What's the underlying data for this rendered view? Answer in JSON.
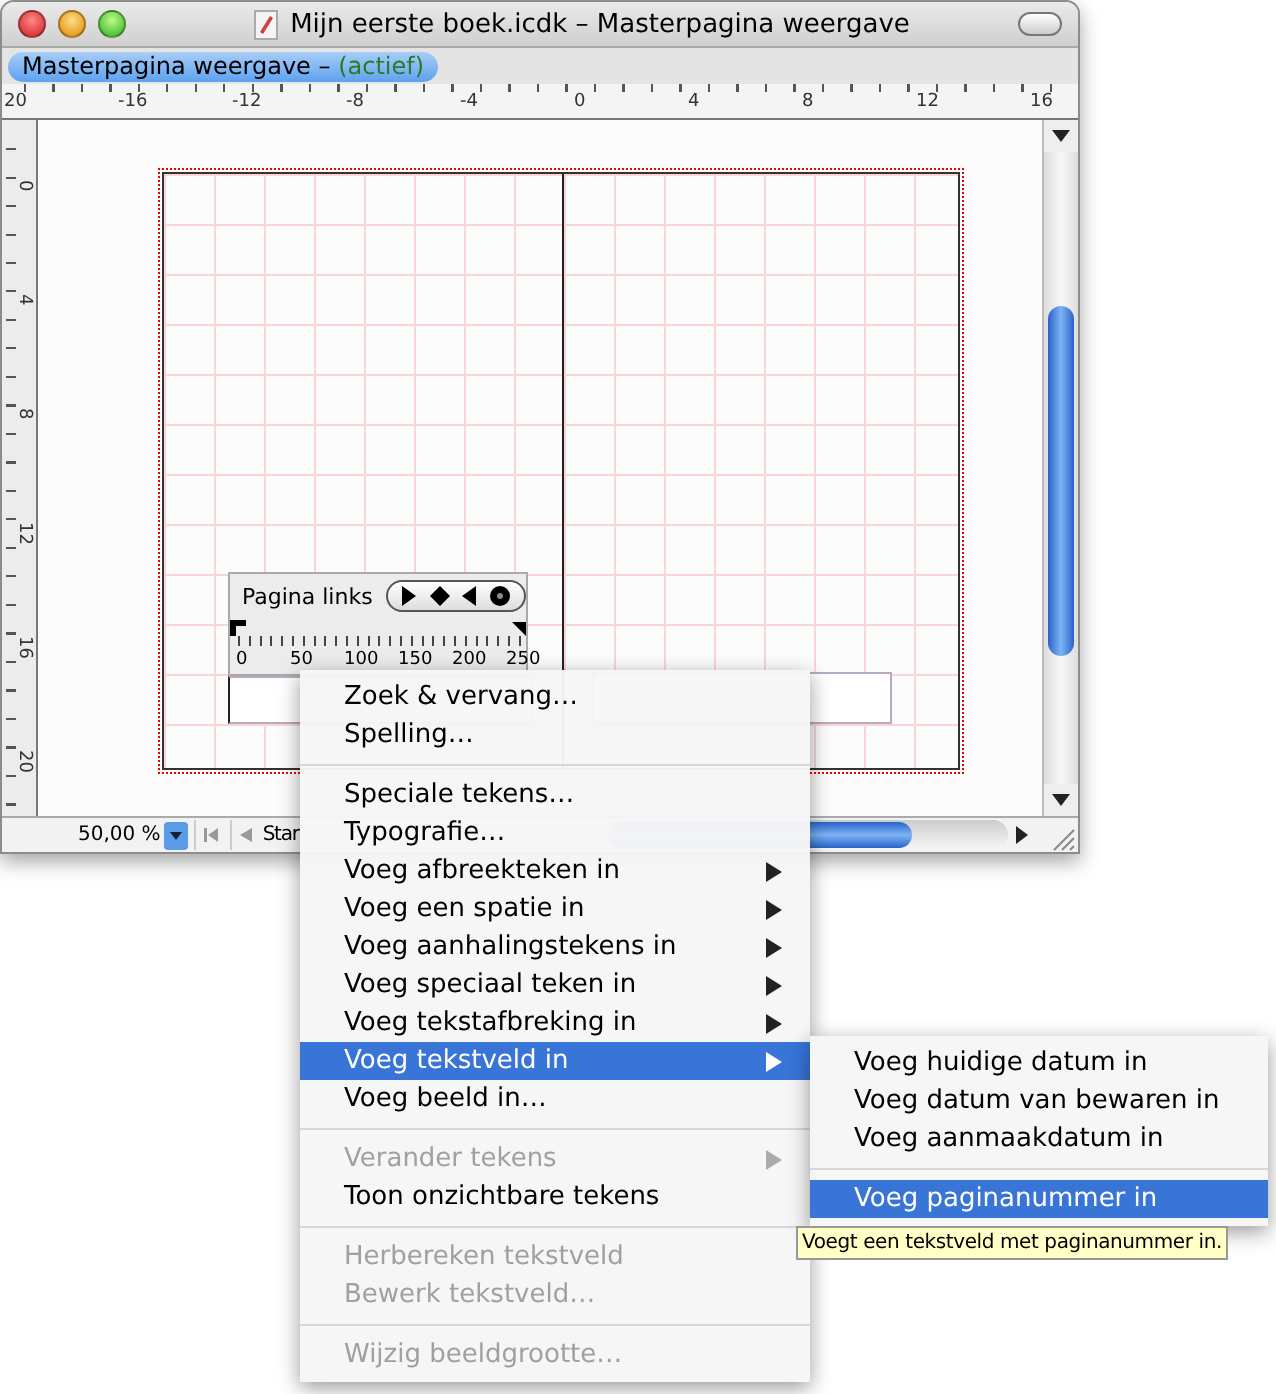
{
  "window": {
    "title": "Mijn eerste boek.icdk – Masterpagina weergave"
  },
  "tabs": [
    {
      "label": "Masterpagina weergave –",
      "status": "(actief)",
      "selected": true
    }
  ],
  "top_ruler": {
    "labels": [
      "20",
      "-16",
      "-12",
      "-8",
      "-4",
      "0",
      "4",
      "8",
      "12",
      "16"
    ]
  },
  "left_ruler": {
    "labels": [
      "0",
      "4",
      "8",
      "12",
      "16",
      "20"
    ]
  },
  "palette": {
    "title": "Pagina links",
    "scale": [
      "0",
      "50",
      "100",
      "150",
      "200",
      "250"
    ]
  },
  "status_bar": {
    "zoom": "50,00 %",
    "page_field": "Star"
  },
  "context_menu": {
    "items": [
      {
        "kind": "item",
        "label": "Zoek & vervang…",
        "has_submenu": false,
        "disabled": false,
        "selected": false
      },
      {
        "kind": "item",
        "label": "Spelling…",
        "has_submenu": false,
        "disabled": false,
        "selected": false
      },
      {
        "kind": "separator"
      },
      {
        "kind": "item",
        "label": "Speciale tekens…",
        "has_submenu": false,
        "disabled": false,
        "selected": false
      },
      {
        "kind": "item",
        "label": "Typografie…",
        "has_submenu": false,
        "disabled": false,
        "selected": false
      },
      {
        "kind": "item",
        "label": "Voeg afbreekteken in",
        "has_submenu": true,
        "disabled": false,
        "selected": false
      },
      {
        "kind": "item",
        "label": "Voeg een spatie in",
        "has_submenu": true,
        "disabled": false,
        "selected": false
      },
      {
        "kind": "item",
        "label": "Voeg aanhalingstekens in",
        "has_submenu": true,
        "disabled": false,
        "selected": false
      },
      {
        "kind": "item",
        "label": "Voeg speciaal teken in",
        "has_submenu": true,
        "disabled": false,
        "selected": false
      },
      {
        "kind": "item",
        "label": "Voeg tekstafbreking in",
        "has_submenu": true,
        "disabled": false,
        "selected": false
      },
      {
        "kind": "item",
        "label": "Voeg tekstveld in",
        "has_submenu": true,
        "disabled": false,
        "selected": true
      },
      {
        "kind": "item",
        "label": "Voeg beeld in…",
        "has_submenu": false,
        "disabled": false,
        "selected": false
      },
      {
        "kind": "separator"
      },
      {
        "kind": "item",
        "label": "Verander tekens",
        "has_submenu": true,
        "disabled": true,
        "selected": false
      },
      {
        "kind": "item",
        "label": "Toon onzichtbare tekens",
        "has_submenu": false,
        "disabled": false,
        "selected": false
      },
      {
        "kind": "separator"
      },
      {
        "kind": "item",
        "label": "Herbereken tekstveld",
        "has_submenu": false,
        "disabled": true,
        "selected": false
      },
      {
        "kind": "item",
        "label": "Bewerk tekstveld…",
        "has_submenu": false,
        "disabled": true,
        "selected": false
      },
      {
        "kind": "separator"
      },
      {
        "kind": "item",
        "label": "Wijzig beeldgrootte…",
        "has_submenu": false,
        "disabled": true,
        "selected": false
      }
    ]
  },
  "submenu": {
    "items": [
      {
        "kind": "item",
        "label": "Voeg huidige datum in",
        "disabled": false,
        "selected": false
      },
      {
        "kind": "item",
        "label": "Voeg datum van bewaren in",
        "disabled": false,
        "selected": false
      },
      {
        "kind": "item",
        "label": "Voeg aanmaakdatum in",
        "disabled": false,
        "selected": false
      },
      {
        "kind": "separator"
      },
      {
        "kind": "item",
        "label": "Voeg paginanummer in",
        "disabled": false,
        "selected": true
      }
    ]
  },
  "tooltip": "Voegt een tekstveld met paginanummer in."
}
